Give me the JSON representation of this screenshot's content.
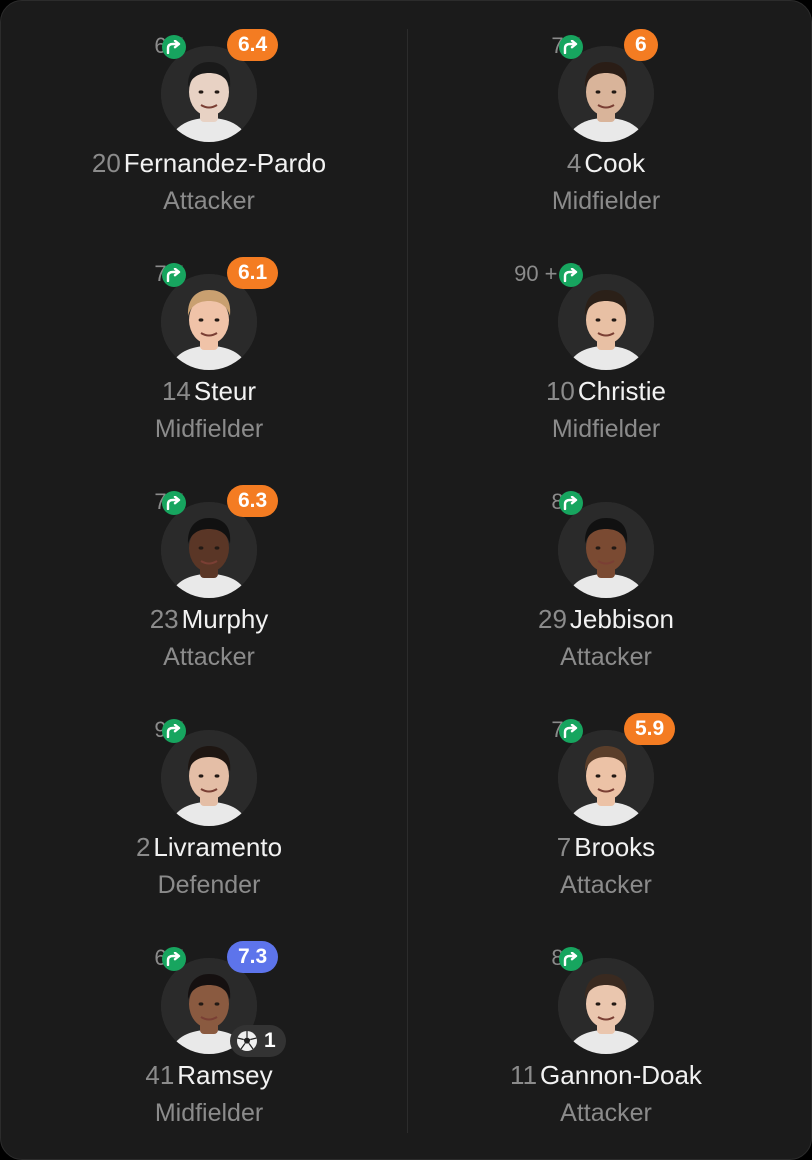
{
  "colors": {
    "card_bg": "#1b1b1b",
    "rating_orange": "#f47c22",
    "rating_blue": "#5d74eb",
    "sub_green": "#17a55f",
    "muted_text": "#8b8b8b"
  },
  "players": [
    {
      "minute": "63′",
      "rating": "6.4",
      "rating_color": "orange",
      "number": "20",
      "name": "Fernandez-Pardo",
      "position": "Attacker",
      "skin": "#e8d2c4",
      "hair": "#1a1a1a"
    },
    {
      "minute": "76′",
      "rating": "6",
      "rating_color": "orange",
      "number": "4",
      "name": "Cook",
      "position": "Midfielder",
      "skin": "#d9b49a",
      "hair": "#2a1d16"
    },
    {
      "minute": "77′",
      "rating": "6.1",
      "rating_color": "orange",
      "number": "14",
      "name": "Steur",
      "position": "Midfielder",
      "skin": "#f0c3a8",
      "hair": "#c9a070"
    },
    {
      "minute": "90 + 6′",
      "rating": "",
      "rating_color": "",
      "number": "10",
      "name": "Christie",
      "position": "Midfielder",
      "skin": "#e8c0a4",
      "hair": "#2b2018"
    },
    {
      "minute": "78′",
      "rating": "6.3",
      "rating_color": "orange",
      "number": "23",
      "name": "Murphy",
      "position": "Attacker",
      "skin": "#5a3626",
      "hair": "#111111"
    },
    {
      "minute": "89′",
      "rating": "",
      "rating_color": "",
      "number": "29",
      "name": "Jebbison",
      "position": "Attacker",
      "skin": "#7a4a32",
      "hair": "#111111"
    },
    {
      "minute": "90′",
      "rating": "",
      "rating_color": "",
      "number": "2",
      "name": "Livramento",
      "position": "Defender",
      "skin": "#e4bea6",
      "hair": "#1e1612"
    },
    {
      "minute": "76′",
      "rating": "5.9",
      "rating_color": "orange",
      "number": "7",
      "name": "Brooks",
      "position": "Attacker",
      "skin": "#ecc2a6",
      "hair": "#5a3e2a"
    },
    {
      "minute": "63′",
      "rating": "7.3",
      "rating_color": "blue",
      "number": "41",
      "name": "Ramsey",
      "position": "Midfielder",
      "skin": "#8a5a40",
      "hair": "#151010",
      "goals": "1"
    },
    {
      "minute": "89′",
      "rating": "",
      "rating_color": "",
      "number": "11",
      "name": "Gannon-Doak",
      "position": "Attacker",
      "skin": "#eac6ae",
      "hair": "#3a2a20"
    }
  ]
}
